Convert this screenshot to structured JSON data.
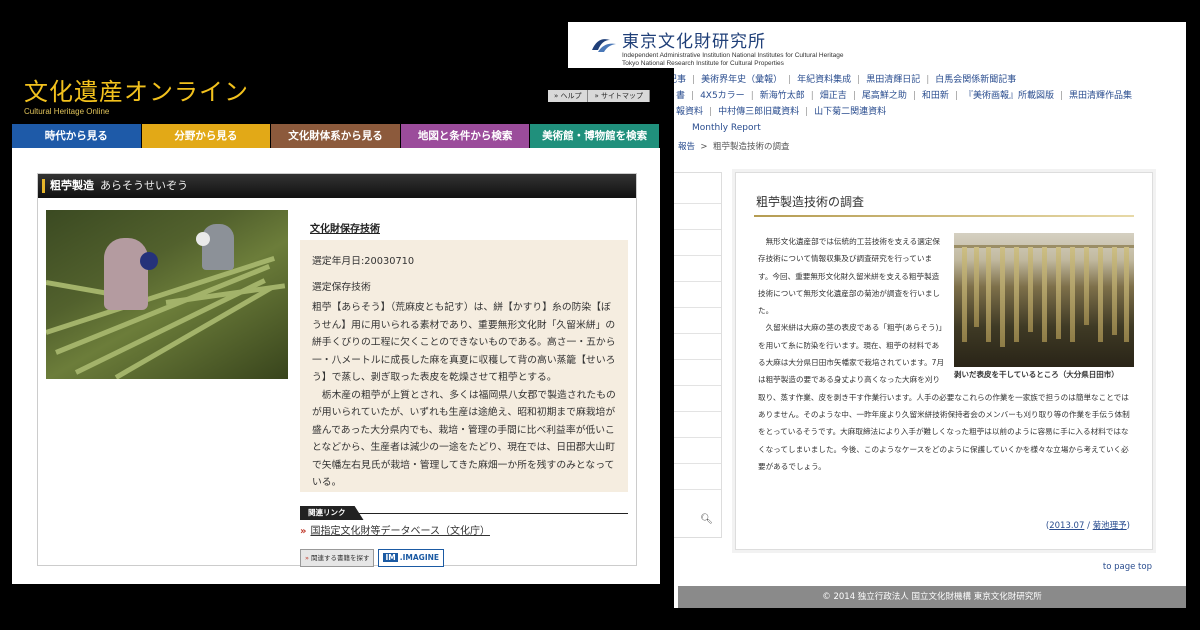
{
  "back_window": {
    "logo_title": "東京文化財研究所",
    "logo_sub1": "Independent Administrative Institution National Institutes for Cultural Heritage",
    "logo_sub2": "Tokyo National Research Institute for Cultural Properties",
    "nav_row1": [
      "記事",
      "美術界年史（彙報）",
      "年紀資料集成",
      "黒田清輝日記",
      "白馬会関係新聞記事"
    ],
    "nav_row2": [
      "書",
      "4X5カラー",
      "新海竹太郎",
      "畑正吉",
      "尾高鮮之助",
      "和田新",
      "『美術画報』所載図版",
      "黒田清輝作品集"
    ],
    "nav_row3": [
      "報資料",
      "中村傳三郎旧蔵資料",
      "山下菊二関連資料"
    ],
    "nav_row4": [
      "Monthly Report"
    ],
    "breadcrumb_link": "報告",
    "breadcrumb_sep": ">",
    "breadcrumb_current": "粗苧製造技術の調査",
    "search_icon": "magnifier-icon",
    "article": {
      "title": "粗苧製造技術の調査",
      "para1": "無形文化遺産部では伝統的工芸技術を支える選定保存技術について情報収集及び調査研究を行っています。今回、重要無形文化財久留米絣を支える粗苧製造技術について無形文化遺産部の菊池が調査を行いました。",
      "para2": "久留米絣は大麻の茎の表皮である「粗苧(あらそう)」を用いて糸に防染を行います。現在、粗苧の材料である大麻は大分県日田市矢幡家で栽培されています。7月は粗苧製造の要である身丈より高くなった大麻を刈り取り、蒸す作業、皮を剥き干す作業行います。人手の必要なこれらの作業を一家族で担うのは簡単なことではありません。そのような中、一昨年度より久留米絣技術保持者会のメンバーも刈り取り等の作業を手伝う体制をとっているそうです。大麻取締法により入手が難しくなった粗苧は以前のように容易に手に入る材料ではなくなってしまいました。今後、このようなケースをどのように保護していくかを様々な立場から考えていく必要があるでしょう。",
      "photo_caption": "剥いだ表皮を干しているところ（大分県日田市）",
      "foot_open": "(",
      "foot_date": "2013.07",
      "foot_slash": " / ",
      "foot_author": "菊池理予",
      "foot_close": ")"
    },
    "to_page_top": "to page top",
    "copyright": "© 2014 独立行政法人 国立文化財機構 東京文化財研究所"
  },
  "front_window": {
    "brand_jp": "文化遺産オンライン",
    "brand_en": "Cultural Heritage Online",
    "top_links": [
      "» ヘルプ",
      "» サイトマップ"
    ],
    "tabs": [
      {
        "label": "時代から見る",
        "color": "#1e5aa8"
      },
      {
        "label": "分野から見る",
        "color": "#e2a917"
      },
      {
        "label": "文化財体系から見る",
        "color": "#8c5a3c"
      },
      {
        "label": "地図と条件から検索",
        "color": "#9b4c9b"
      },
      {
        "label": "美術館・博物館を検索",
        "color": "#20907c"
      }
    ],
    "heading_title": "粗苧製造",
    "heading_reading": "あらそうせいぞう",
    "category_link": "文化財保存技術",
    "selected_date": "選定年月日:20030710",
    "selected_kind": "選定保存技術",
    "description1": "粗苧【あらそう】（荒麻皮とも記す）は、絣【かすり】糸の防染【ぼうせん】用に用いられる素材であり、重要無形文化財「久留米絣」の絣手くびりの工程に欠くことのできないものである。高さ一・五から一・八メートルに成長した麻を真夏に収穫して背の高い蒸籠【せいろう】で蒸し、剥ぎ取った表皮を乾燥させて粗苧とする。",
    "description2": "栃木産の粗苧が上質とされ、多くは福岡県八女郡で製造されたものが用いられていたが、いずれも生産は途絶え、昭和初期まで麻栽培が盛んであった大分県内でも、栽培・管理の手間に比べ利益率が低いことなどから、生産者は減少の一途をたどり、現在では、日田郡大山町で矢幡左右見氏が栽培・管理してきた麻畑一か所を残すのみとなっている。",
    "related_heading": "関連リンク",
    "related_arrow": "»",
    "related_link": "国指定文化財等データベース（文化庁）",
    "search_books_arrow": "»",
    "search_books": "関連する書籍を探す",
    "imagine_mark": "IM",
    "imagine_label": ".IMAGINE"
  }
}
